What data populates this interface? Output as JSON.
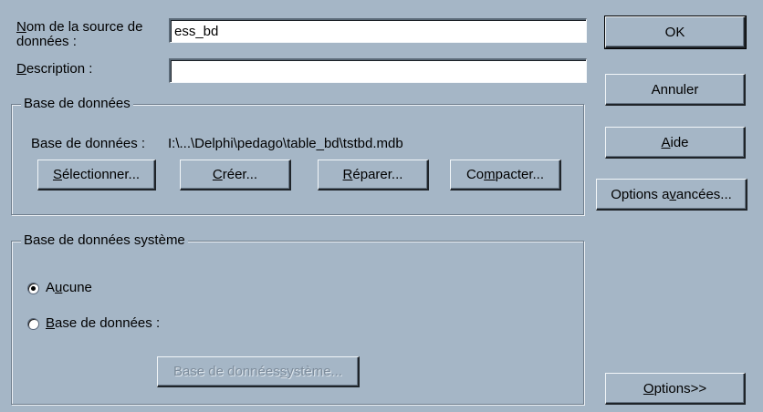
{
  "form": {
    "dsn_label_line1": "Nom de la source de",
    "dsn_label_line2": "données :",
    "dsn_label_first": "N",
    "dsn_label_rest": "om de la source de",
    "dsn_value": "ess_bd",
    "desc_label_first": "D",
    "desc_label_rest": "escription :",
    "desc_value": ""
  },
  "db_group": {
    "title": "Base de données",
    "path_label": "Base de données :",
    "path_value": "I:\\...\\Delphi\\pedago\\table_bd\\tstbd.mdb",
    "buttons": {
      "select": {
        "mnemonic": "S",
        "rest": "électionner..."
      },
      "create": {
        "mnemonic": "C",
        "rest": "réer..."
      },
      "repair": {
        "mnemonic": "R",
        "rest": "éparer..."
      },
      "compact": {
        "pre": "Co",
        "mnemonic": "m",
        "rest": "pacter..."
      }
    }
  },
  "system_group": {
    "title": "Base de données système",
    "option_none": {
      "pre": "A",
      "mnemonic": "u",
      "rest": "cune",
      "selected": true
    },
    "option_db": {
      "mnemonic": "B",
      "rest": "ase de données :",
      "selected": false
    },
    "system_db_button": {
      "pre": "Base de données ",
      "mnemonic": "s",
      "rest": "ystème..."
    }
  },
  "actions": {
    "ok": "OK",
    "cancel": "Annuler",
    "help": {
      "mnemonic": "A",
      "rest": "ide"
    },
    "advanced": {
      "pre": "Options a",
      "mnemonic": "v",
      "rest": "ancées..."
    },
    "options": {
      "mnemonic": "O",
      "rest": "ptions>>"
    }
  }
}
